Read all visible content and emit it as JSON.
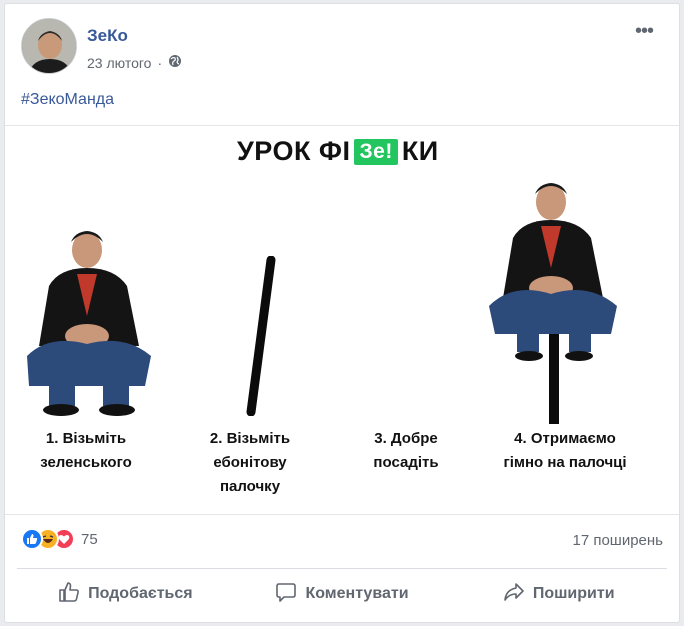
{
  "post": {
    "author": "ЗеКо",
    "date": "23 лютого",
    "separator": "·",
    "privacy_icon": "globe-icon",
    "more_icon": "•••",
    "text": "#ЗекоМанда"
  },
  "image": {
    "title_before": "УРОК ФІ",
    "title_badge": "Зе!",
    "title_after": "КИ",
    "steps": [
      {
        "line1": "1. Візьміть",
        "line2": "зеленського",
        "line3": ""
      },
      {
        "line1": "2. Візьміть",
        "line2": "ебонітову",
        "line3": "палочку"
      },
      {
        "line1": "3. Добре",
        "line2": "посадіть",
        "line3": ""
      },
      {
        "line1": "4. Отримаємо",
        "line2": "гімно на палочці",
        "line3": ""
      }
    ]
  },
  "stats": {
    "reaction_count": "75",
    "shares": "17 поширень",
    "reaction_icons": [
      "like-icon",
      "haha-icon",
      "love-icon"
    ]
  },
  "actions": {
    "like": "Подобається",
    "comment": "Коментувати",
    "share": "Поширити"
  },
  "colors": {
    "link": "#385898",
    "ze_green": "#22c55e",
    "like_blue": "#1877f2",
    "love_red": "#f33e58",
    "haha_yellow": "#f7b125"
  }
}
